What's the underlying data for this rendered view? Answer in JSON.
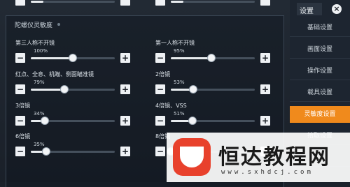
{
  "section_title": "陀螺仪灵敏度",
  "settings": [
    {
      "label": "第三人称不开镜",
      "value_text": "100%",
      "fraction": 0.5
    },
    {
      "label": "第一人称不开镜",
      "value_text": "95%",
      "fraction": 0.48
    },
    {
      "label": "红点、全息、机瞄、侧面瞄准镜",
      "value_text": "79%",
      "fraction": 0.4
    },
    {
      "label": "2倍镜",
      "value_text": "53%",
      "fraction": 0.27
    },
    {
      "label": "3倍镜",
      "value_text": "34%",
      "fraction": 0.17
    },
    {
      "label": "4倍镜、VSS",
      "value_text": "51%",
      "fraction": 0.26
    },
    {
      "label": "6倍镜",
      "value_text": "35%",
      "fraction": 0.18
    },
    {
      "label": "8倍镜",
      "value_text": "",
      "fraction": 0.0
    }
  ],
  "buttons": {
    "minus": "−",
    "plus": "+"
  },
  "sidebar": {
    "title": "设置",
    "close": "×",
    "items": [
      {
        "label": "基础设置",
        "active": false
      },
      {
        "label": "画面设置",
        "active": false
      },
      {
        "label": "操作设置",
        "active": false
      },
      {
        "label": "载具设置",
        "active": false
      },
      {
        "label": "灵敏度设置",
        "active": true
      },
      {
        "label": "拾取设置",
        "active": false
      },
      {
        "label": "",
        "active": false
      }
    ]
  },
  "watermark": {
    "text": "恒达教程网",
    "url": "www.sxhdcj.com"
  },
  "colors": {
    "accent": "#f08a1c",
    "watermark_logo": "#e8412c"
  }
}
